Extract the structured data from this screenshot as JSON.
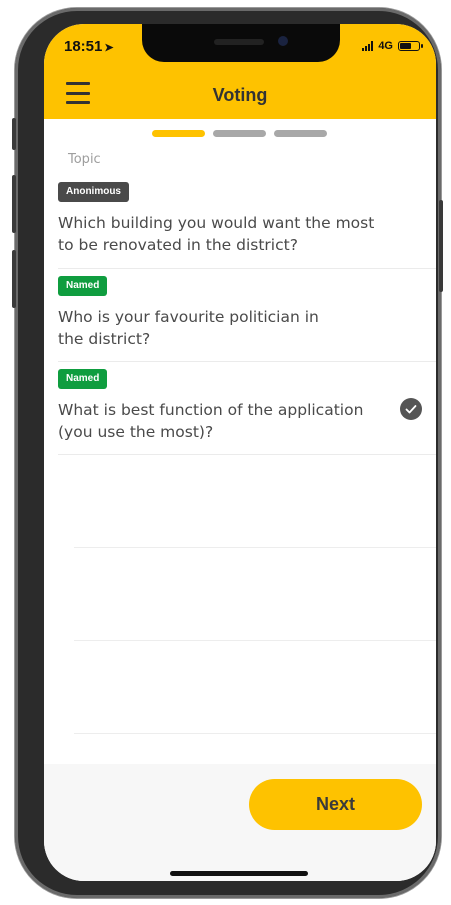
{
  "status_bar": {
    "time": "18:51",
    "location_icon": "location-arrow-icon",
    "network": "4G",
    "signal_icon": "signal-bars-icon",
    "battery_icon": "battery-icon"
  },
  "header": {
    "menu_icon": "hamburger-menu-icon",
    "title": "Voting",
    "background_color": "#fec200"
  },
  "stepper": {
    "total_steps": 3,
    "current_step": 1,
    "active_color": "#fec200",
    "inactive_color": "#a8a8a8"
  },
  "section_label": "Topic",
  "topics": [
    {
      "badge": "Anonimous",
      "badge_color": "#4a4a4a",
      "question_lines": [
        "Which building you would want the most",
        "to be renovated in the district?"
      ],
      "selected": false
    },
    {
      "badge": "Named",
      "badge_color": "#0f9d3f",
      "question_lines": [
        "Who is your favourite politician in",
        "the district?"
      ],
      "selected": false
    },
    {
      "badge": "Named",
      "badge_color": "#0f9d3f",
      "question_lines": [
        "What is best function of the application",
        "(you use the most)?"
      ],
      "selected": true,
      "selected_icon": "check-circle-icon"
    }
  ],
  "footer": {
    "next_label": "Next",
    "button_color": "#fec200"
  }
}
